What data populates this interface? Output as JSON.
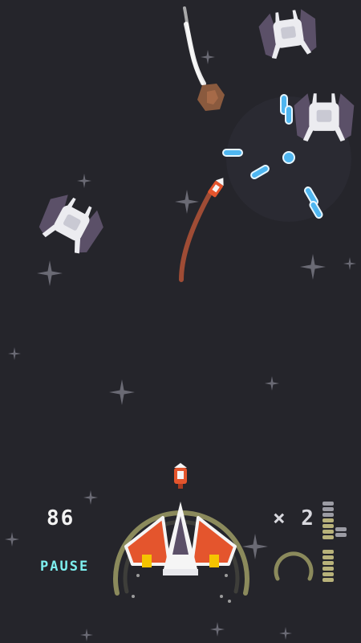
{
  "hud": {
    "score": "86",
    "pause_label": "PAUSE",
    "multiplier": "× 2"
  },
  "colors": {
    "background": "#25252b",
    "accent": "#7ef0f0",
    "player_red": "#e4552d",
    "enemy_purple": "#5b5068",
    "laser_blue": "#4fb6f0",
    "ring_olive": "#8b8a5c"
  },
  "icons": [
    "star-icon",
    "player-ship-icon",
    "enemy-ship-icon",
    "asteroid-icon",
    "missile-icon",
    "ammo-gauge-icon"
  ]
}
